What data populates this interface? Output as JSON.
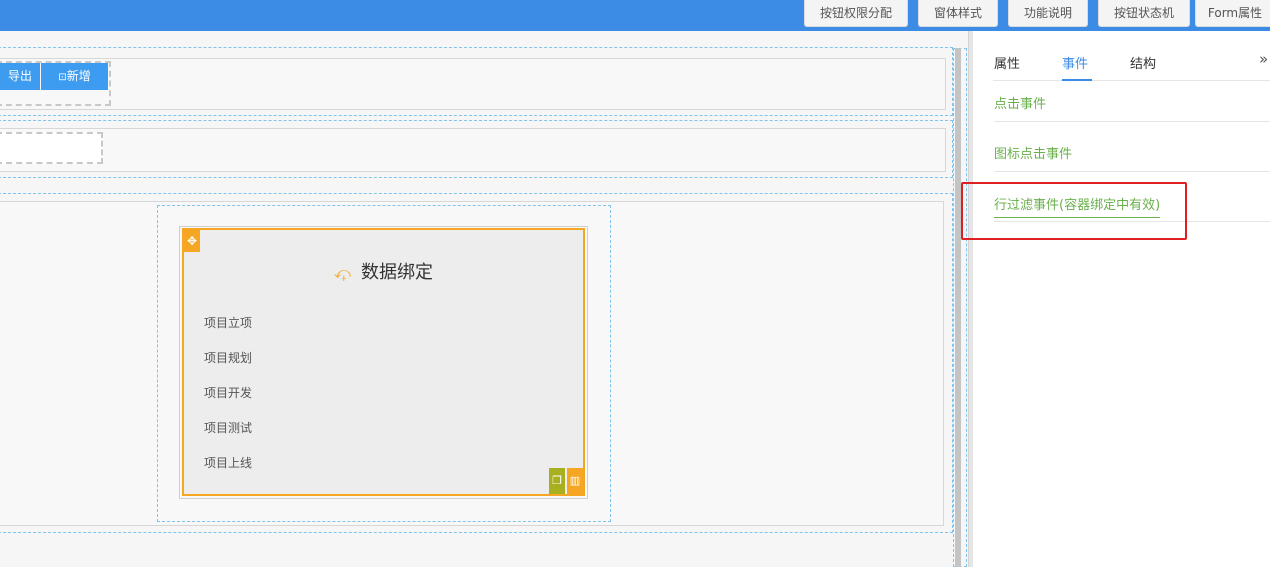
{
  "toolbar": {
    "buttons": [
      {
        "label": "按钮权限分配"
      },
      {
        "label": "窗体样式"
      },
      {
        "label": "功能说明"
      },
      {
        "label": "按钮状态机"
      },
      {
        "label": "Form属性"
      }
    ]
  },
  "canvas": {
    "export_label": "导出",
    "add_label": "新增",
    "card": {
      "title": "数据绑定",
      "items": [
        "项目立项",
        "项目规划",
        "项目开发",
        "项目测试",
        "项目上线"
      ]
    }
  },
  "panel": {
    "tabs": [
      {
        "label": "属性"
      },
      {
        "label": "事件"
      },
      {
        "label": "结构"
      }
    ],
    "active_tab": "事件",
    "collapse_glyph": "»",
    "events": [
      {
        "label": "点击事件"
      },
      {
        "label": "图标点击事件"
      },
      {
        "label": "行过滤事件(容器绑定中有效)"
      }
    ]
  },
  "colors": {
    "topbar": "#3c8ce6",
    "accent_orange": "#f5a623",
    "event_green": "#6ab04c",
    "highlight_red": "#e02020"
  }
}
